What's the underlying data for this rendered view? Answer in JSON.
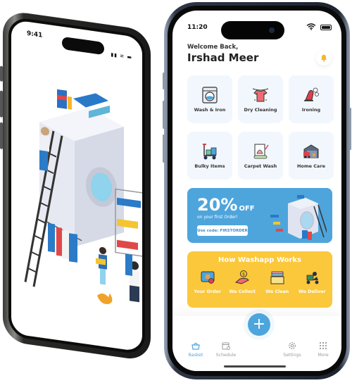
{
  "left_phone": {
    "status_time": "9:41",
    "status_icons": [
      "signal-icon",
      "wifi-icon",
      "battery-icon"
    ],
    "illustration": "laundry-isometric-illustration"
  },
  "right_phone": {
    "status": {
      "time": "11:20",
      "icons": [
        "wifi-icon",
        "battery-icon"
      ]
    },
    "header": {
      "greeting": "Welcome Back,",
      "user_name": "Irshad Meer",
      "notification_icon": "bell-icon"
    },
    "services": [
      {
        "label": "Wash & Iron",
        "icon": "washing-machine-icon"
      },
      {
        "label": "Dry Cleaning",
        "icon": "tshirt-hanger-icon"
      },
      {
        "label": "Ironing",
        "icon": "iron-icon"
      },
      {
        "label": "Bulky Items",
        "icon": "hand-truck-icon"
      },
      {
        "label": "Carpet Wash",
        "icon": "carpet-icon"
      },
      {
        "label": "Home Care",
        "icon": "garage-icon"
      }
    ],
    "promo": {
      "percent": "20%",
      "off": "OFF",
      "subtitle": "on your first Order!",
      "code_label": "Use code: FIRSTORDER"
    },
    "how_it_works": {
      "title": "How Washapp Works",
      "steps": [
        {
          "label": "Your Order",
          "icon": "order-icon"
        },
        {
          "label": "We Collect",
          "icon": "hand-coin-icon"
        },
        {
          "label": "We Clean",
          "icon": "basket-clothes-icon"
        },
        {
          "label": "We Deliver",
          "icon": "scooter-icon"
        }
      ]
    },
    "tabbar": {
      "fab_label": "+",
      "tabs": [
        {
          "label": "Basket",
          "icon": "basket-icon",
          "active": true
        },
        {
          "label": "Schedule",
          "icon": "calendar-icon",
          "active": false
        },
        {
          "label": "Settings",
          "icon": "gear-icon",
          "active": false
        },
        {
          "label": "More",
          "icon": "grid-dots-icon",
          "active": false
        }
      ]
    }
  },
  "colors": {
    "primary_blue": "#4ea5dc",
    "accent_yellow": "#fbc83b",
    "card_bg": "#f2f7fd"
  }
}
